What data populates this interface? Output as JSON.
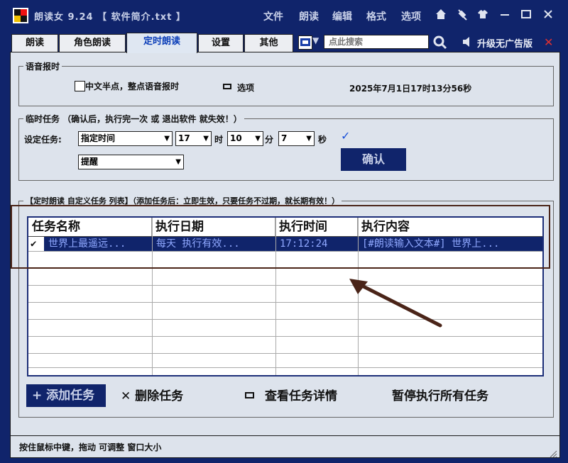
{
  "window": {
    "app_title": "朗读女 9.24 【 软件简介.txt 】",
    "menu": [
      "文件",
      "朗读",
      "编辑",
      "格式",
      "选项"
    ],
    "title_icons": [
      "home-icon",
      "pin-icon",
      "shirt-icon",
      "minimize-icon",
      "maximize-icon",
      "close-icon"
    ]
  },
  "tabs": [
    "朗读",
    "角色朗读",
    "定时朗读",
    "设置",
    "其他"
  ],
  "active_tab": "定时朗读",
  "search": {
    "placeholder": "点此搜索"
  },
  "upgrade_label": "升级无广告版",
  "voice_announce": {
    "legend": "语音报时",
    "checkbox_label": "中文半点，整点语音报时",
    "options_label": "选项",
    "datetime": "2025年7月1日17时13分56秒"
  },
  "temp_task": {
    "legend": "临时任务  （确认后，执行完一次 或 退出软件 就失效！）",
    "set_label": "设定任务:",
    "mode": "指定时间",
    "hour": "17",
    "hour_unit": "时",
    "minute": "10",
    "minute_unit": "分",
    "second": "7",
    "second_unit": "秒",
    "action": "提醒",
    "confirm_label": "确认"
  },
  "custom_tasks": {
    "legend": "【定时朗读  自定义任务 列表】（添加任务后：立即生效，只要任务不过期，就长期有效！）",
    "columns": [
      "任务名称",
      "执行日期",
      "执行时间",
      "执行内容"
    ],
    "rows": [
      {
        "checked": true,
        "name": "世界上最遥远...",
        "date": "每天  执行有效...",
        "time": "17:12:24",
        "content": "[#朗读输入文本#] 世界上..."
      }
    ],
    "add_label": "添加任务",
    "delete_label": "删除任务",
    "details_label": "查看任务详情",
    "pause_label": "暂停执行所有任务"
  },
  "status_text": "按住鼠标中键，拖动 可调整 窗口大小",
  "colors": {
    "titlebar": "#10246b",
    "panel": "#dde3ec",
    "selection": "#10246b",
    "annotation": "#4a2418"
  }
}
